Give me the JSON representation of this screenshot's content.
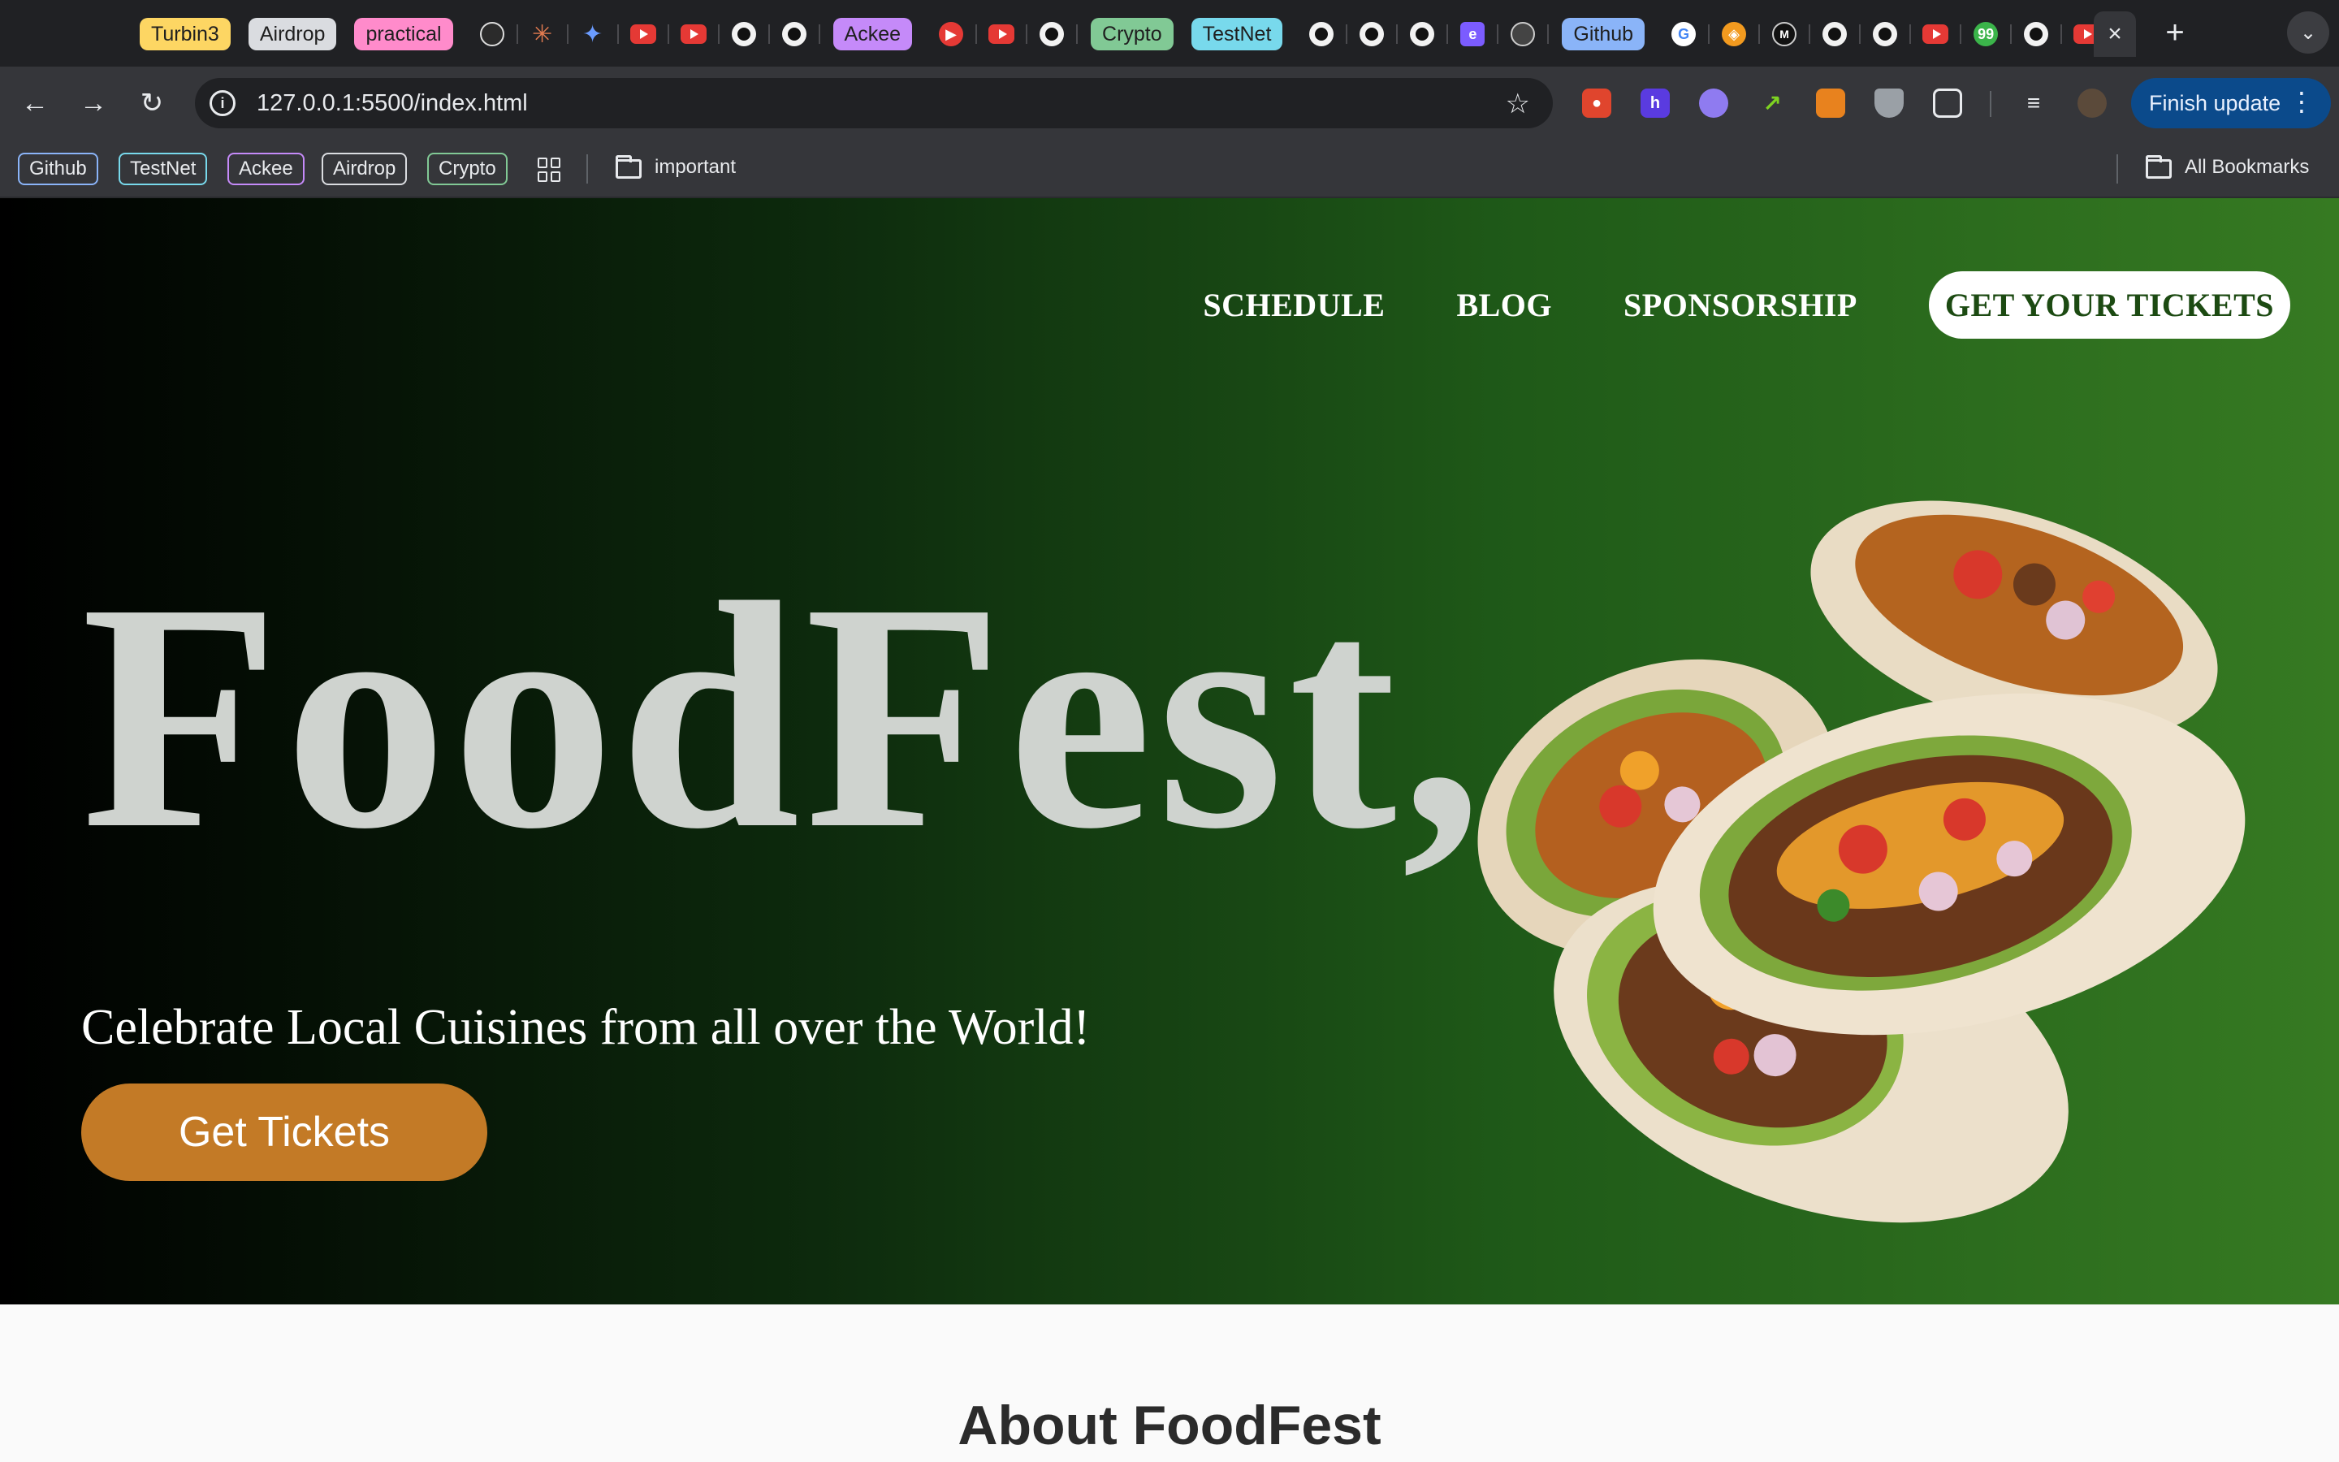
{
  "browser": {
    "tab_groups": [
      "Turbin3",
      "Airdrop",
      "practical",
      "Ackee",
      "Crypto",
      "TestNet",
      "Github"
    ],
    "active_tab_close": "×",
    "new_tab": "+",
    "url": "127.0.0.1:5500/index.html",
    "finish_update": "Finish update",
    "bookmarks": [
      "Github",
      "TestNet",
      "Ackee",
      "Airdrop",
      "Crypto"
    ],
    "bookmark_folder": "important",
    "all_bookmarks": "All Bookmarks",
    "colors": {
      "group_turbin3": "#fdd663",
      "group_airdrop": "#dadce0",
      "group_practical": "#ff8bcb",
      "group_ackee": "#c58af9",
      "group_crypto": "#81c995",
      "group_testnet": "#78d9ec",
      "group_github": "#8ab4f8"
    }
  },
  "page": {
    "nav": {
      "schedule": "SCHEDULE",
      "blog": "BLOG",
      "sponsorship": "SPONSORSHIP",
      "cta": "GET YOUR TICKETS"
    },
    "hero": {
      "title": "FoodFest,",
      "subtitle": "Celebrate Local Cuisines from all over the World!",
      "button": "Get Tickets"
    },
    "about_heading": "About FoodFest",
    "colors": {
      "hero_gradient_start": "#000000",
      "hero_gradient_end": "#367a22",
      "button": "#c37a26",
      "title": "#cfd3cf"
    }
  }
}
